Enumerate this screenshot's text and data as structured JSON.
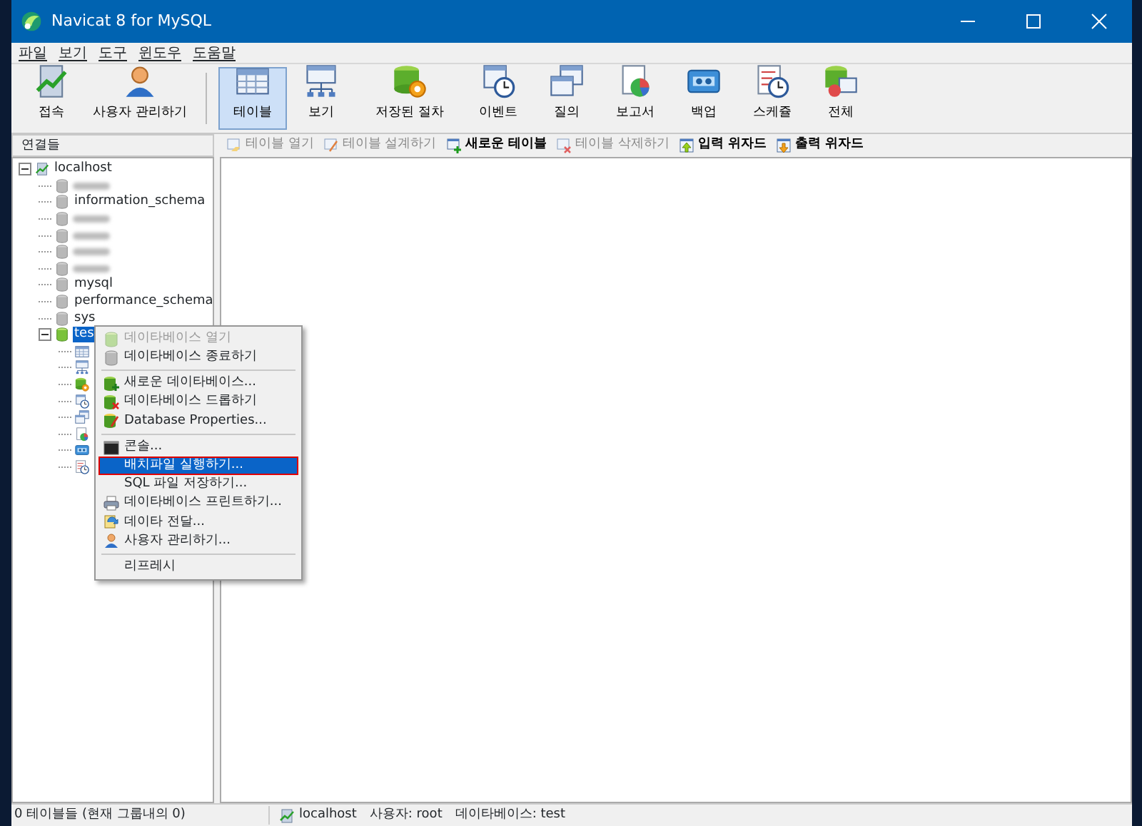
{
  "window": {
    "title": "Navicat 8 for MySQL"
  },
  "menu": [
    "파일",
    "보기",
    "도구",
    "윈도우",
    "도움말"
  ],
  "toolbar": [
    {
      "label": "접속",
      "kind": "connect",
      "selected": false
    },
    {
      "label": "사용자 관리하기",
      "kind": "user",
      "selected": false
    },
    {
      "label": "테이블",
      "kind": "table",
      "selected": true
    },
    {
      "label": "보기",
      "kind": "view",
      "selected": false
    },
    {
      "label": "저장된 절차",
      "kind": "procedure",
      "selected": false
    },
    {
      "label": "이벤트",
      "kind": "event",
      "selected": false
    },
    {
      "label": "질의",
      "kind": "query",
      "selected": false
    },
    {
      "label": "보고서",
      "kind": "report",
      "selected": false
    },
    {
      "label": "백업",
      "kind": "backup",
      "selected": false
    },
    {
      "label": "스케쥴",
      "kind": "schedule",
      "selected": false
    },
    {
      "label": "전체",
      "kind": "all",
      "selected": false
    }
  ],
  "sidebar": {
    "title": "연결들",
    "tree": [
      {
        "label": "localhost",
        "kind": "server",
        "expanded": true,
        "children": [
          {
            "kind": "redacted"
          },
          {
            "label": "information_schema",
            "kind": "db"
          },
          {
            "kind": "redacted"
          },
          {
            "kind": "redacted"
          },
          {
            "kind": "redacted"
          },
          {
            "kind": "redacted"
          },
          {
            "label": "mysql",
            "kind": "db"
          },
          {
            "label": "performance_schema",
            "kind": "db"
          },
          {
            "label": "sys",
            "kind": "db"
          },
          {
            "label": "tes",
            "kind": "db-open",
            "selected": true,
            "expanded": true,
            "children": [
              {
                "kind": "table"
              },
              {
                "kind": "view"
              },
              {
                "kind": "procedure"
              },
              {
                "kind": "event"
              },
              {
                "kind": "query"
              },
              {
                "kind": "report"
              },
              {
                "kind": "backup"
              },
              {
                "kind": "schedule"
              }
            ]
          }
        ]
      }
    ]
  },
  "object_toolbar": [
    {
      "label": "테이블 열기",
      "kind": "open",
      "disabled": true
    },
    {
      "label": "테이블 설계하기",
      "kind": "design",
      "disabled": true
    },
    {
      "label": "새로운 테이블",
      "kind": "new",
      "disabled": false
    },
    {
      "label": "테이블 삭제하기",
      "kind": "delete",
      "disabled": true
    },
    {
      "label": "입력 위자드",
      "kind": "import",
      "disabled": false
    },
    {
      "label": "출력 위자드",
      "kind": "export",
      "disabled": false
    }
  ],
  "context_menu": [
    {
      "kind": "item",
      "label": "데이타베이스 열기",
      "disabled": true,
      "selected": false
    },
    {
      "kind": "item",
      "label": "데이타베이스 종료하기",
      "disabled": false,
      "selected": false
    },
    {
      "kind": "separator"
    },
    {
      "kind": "item",
      "label": "새로운 데이타베이스...",
      "disabled": false,
      "selected": false
    },
    {
      "kind": "item",
      "label": "데이타베이스 드롭하기",
      "disabled": false,
      "selected": false
    },
    {
      "kind": "item",
      "label": "Database Properties...",
      "disabled": false,
      "selected": false
    },
    {
      "kind": "separator"
    },
    {
      "kind": "item",
      "label": "콘솔...",
      "disabled": false,
      "selected": false
    },
    {
      "kind": "item",
      "label": "배치파일 실행하기...",
      "disabled": false,
      "selected": true
    },
    {
      "kind": "item",
      "label": "SQL 파일 저장하기...",
      "disabled": false,
      "selected": false
    },
    {
      "kind": "item",
      "label": "데이타베이스 프린트하기...",
      "disabled": false,
      "selected": false
    },
    {
      "kind": "item",
      "label": "데이타 전달...",
      "disabled": false,
      "selected": false
    },
    {
      "kind": "item",
      "label": "사용자 관리하기...",
      "disabled": false,
      "selected": false
    },
    {
      "kind": "separator"
    },
    {
      "kind": "item",
      "label": "리프레시",
      "disabled": false,
      "selected": false
    }
  ],
  "status_bar": {
    "left": "0 테이블들 (현재 그룹내의 0)",
    "connection": "localhost",
    "user": "사용자: root",
    "database": "데이타베이스: test"
  }
}
